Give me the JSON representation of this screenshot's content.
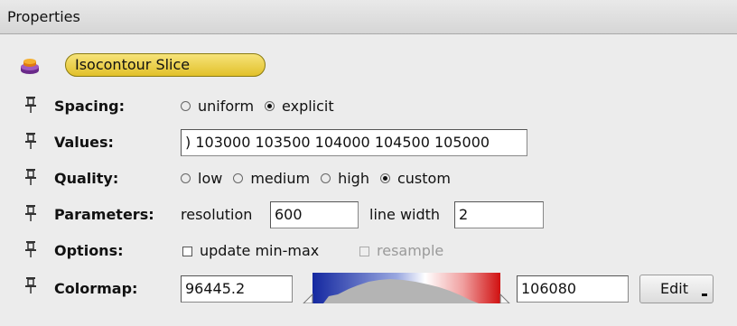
{
  "header": {
    "title": "Properties"
  },
  "object": {
    "name": "Isocontour Slice"
  },
  "spacing": {
    "label": "Spacing:",
    "options": [
      {
        "label": "uniform",
        "checked": false
      },
      {
        "label": "explicit",
        "checked": true
      }
    ]
  },
  "values": {
    "label": "Values:",
    "value": ") 103000 103500 104000 104500 105000"
  },
  "quality": {
    "label": "Quality:",
    "options": [
      {
        "label": "low",
        "checked": false
      },
      {
        "label": "medium",
        "checked": false
      },
      {
        "label": "high",
        "checked": false
      },
      {
        "label": "custom",
        "checked": true
      }
    ]
  },
  "parameters": {
    "label": "Parameters:",
    "resolution_label": "resolution",
    "resolution_value": "600",
    "line_width_label": "line width",
    "line_width_value": "2"
  },
  "options": {
    "label": "Options:",
    "update_min_max": {
      "label": "update min-max",
      "checked": false
    },
    "resample": {
      "label": "resample",
      "checked": false,
      "enabled": false
    }
  },
  "colormap": {
    "label": "Colormap:",
    "min_value": "96445.2",
    "max_value": "106080",
    "edit_label": "Edit",
    "colors": {
      "low": "#1428a0",
      "mid": "#ffffff",
      "high": "#d01010",
      "histogram": "#b4b4b4"
    }
  }
}
